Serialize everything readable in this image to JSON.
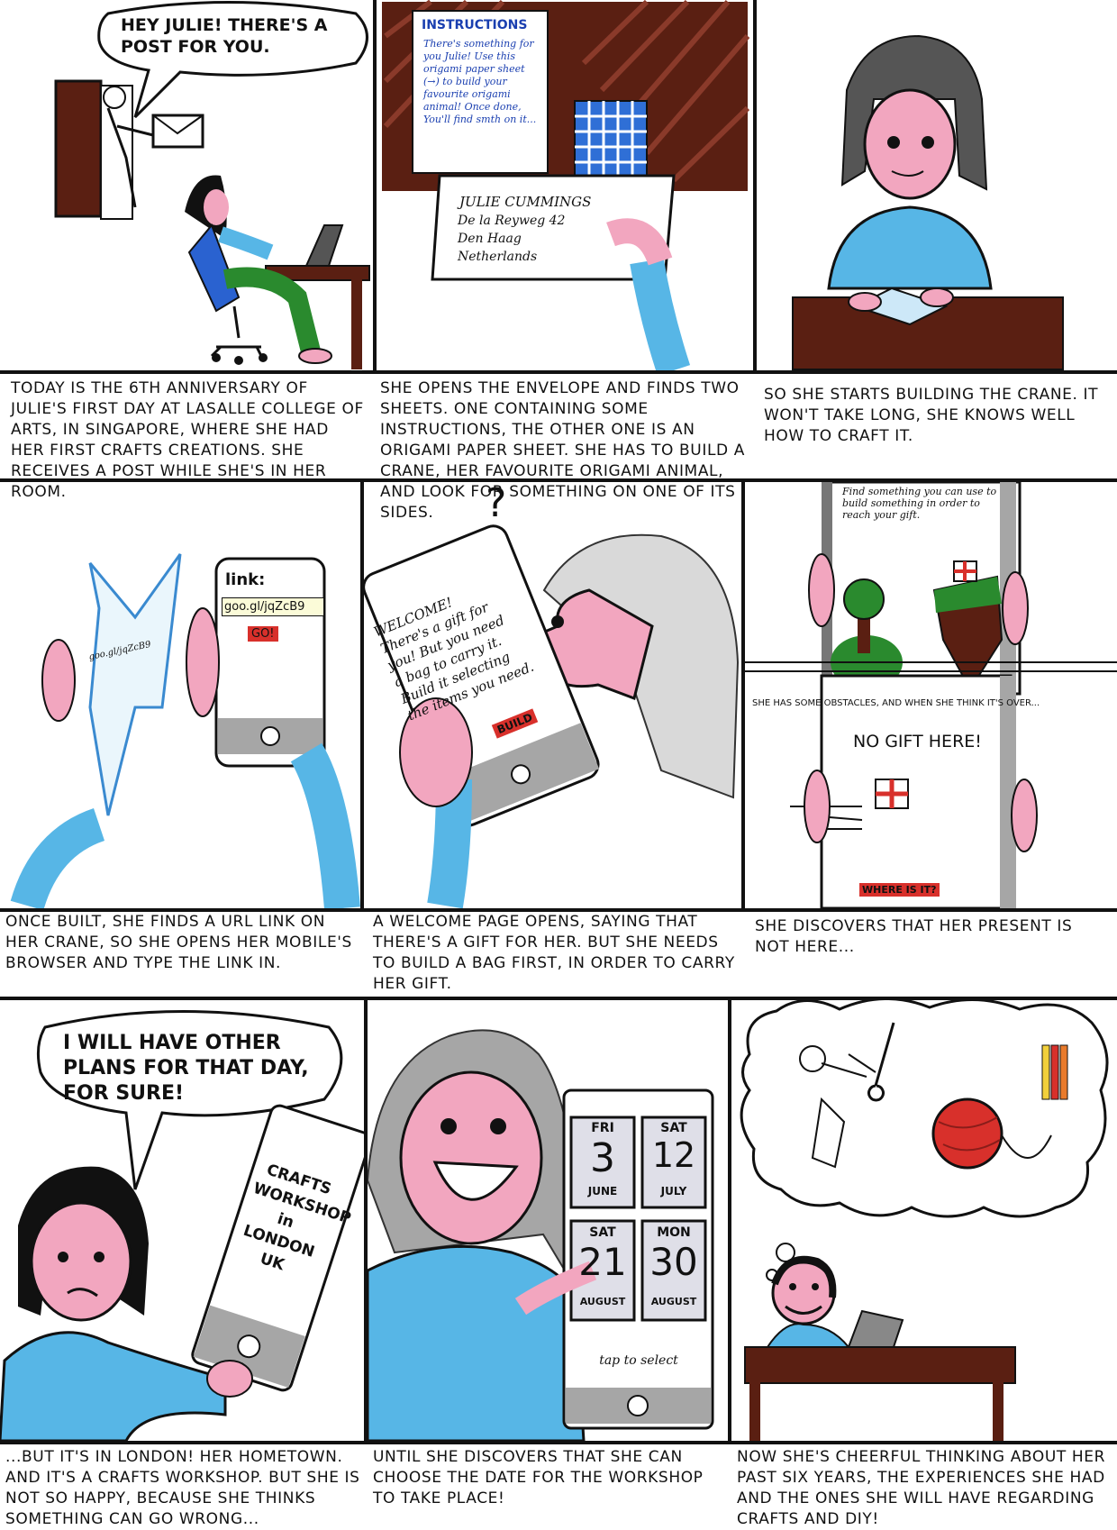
{
  "row1": {
    "panel1": {
      "speech": "HEY JULIE! THERE'S A POST FOR YOU."
    },
    "panel2": {
      "instructions_title": "INSTRUCTIONS",
      "instructions_body": "There's something for you Julie! Use this origami paper sheet (→) to build your favourite origami animal! Once done, You'll find smth on it...",
      "address_name": "Julie Cummings",
      "address_line1": "De la Reyweg 42",
      "address_line2": "Den Haag",
      "address_line3": "Netherlands"
    },
    "captions": [
      "Today is the 6th anniversary of Julie's first day at Lasalle college of arts, in Singapore, where she had her first crafts creations. She receives a post while she's in her room.",
      "She opens the envelope and finds two sheets. One containing some instructions, the other one is an origami paper sheet. She has to build a crane, her favourite origami animal, and look for something on one of its sides.",
      "So she starts building the crane. It won't take long, she knows well how to craft it."
    ]
  },
  "row2": {
    "panel1": {
      "crane_text": "goo.gl/jqZcB9",
      "phone_label": "link:",
      "phone_link": "goo.gl/jqZcB9",
      "phone_button": "GO!"
    },
    "panel2": {
      "thought": "?",
      "phone_text": "WELCOME! There's a gift for you! But you need a bag to carry it. Build it selecting the items you need.",
      "phone_button": "BUILD"
    },
    "panel3": {
      "screen_top_text": "Find something you can use to build something in order to reach your gift.",
      "middle_caption": "She has some obstacles, and when she think it's over...",
      "screen_bottom_title": "NO GIFT HERE!",
      "screen_bottom_button": "WHERE IS IT?"
    },
    "captions": [
      "Once built, she finds a URL link on her crane, so she opens her mobile's browser and type the link in.",
      "A welcome page opens, saying that there's a gift for her. But she needs to build a bag first, in order to carry her gift.",
      "She discovers that her present is not here..."
    ]
  },
  "row3": {
    "panel1": {
      "speech": "I WILL HAVE OTHER PLANS FOR THAT DAY, FOR SURE!",
      "phone_text": "CRAFTS WORKSHOP in LONDON UK"
    },
    "panel2": {
      "dates": [
        {
          "day": "FRI",
          "num": "3",
          "month": "JUNE"
        },
        {
          "day": "SAT",
          "num": "12",
          "month": "JULY"
        },
        {
          "day": "SAT",
          "num": "21",
          "month": "AUGUST"
        },
        {
          "day": "MON",
          "num": "30",
          "month": "AUGUST"
        }
      ],
      "tap_text": "tap to select"
    },
    "captions": [
      "...But it's in London! Her hometown. And it's a crafts workshop. But she is not so happy, because she thinks something can go wrong...",
      "Until she discovers that she can choose the date for the workshop to take place!",
      "Now she's cheerful thinking about her past six years, the experiences she had and the ones she will have regarding crafts and DIY!"
    ]
  },
  "colors": {
    "ink": "#111111",
    "skin": "#f2a6bf",
    "blue": "#57b6e6",
    "brown": "#5a1f12",
    "green": "#2a8a2e",
    "red": "#d8302b",
    "gray": "#a6a6a6"
  }
}
